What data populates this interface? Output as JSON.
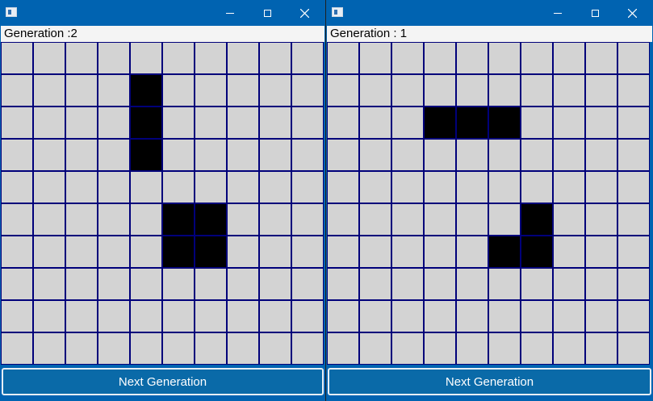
{
  "windows": [
    {
      "generation_label": "Generation :2",
      "button_label": "Next Generation",
      "controls": [
        "minimize-icon",
        "maximize-icon",
        "close-icon"
      ],
      "grid": {
        "rows": 10,
        "cols": 10,
        "alive": [
          [
            1,
            4
          ],
          [
            2,
            4
          ],
          [
            3,
            4
          ],
          [
            5,
            5
          ],
          [
            5,
            6
          ],
          [
            6,
            5
          ],
          [
            6,
            6
          ]
        ]
      }
    },
    {
      "generation_label": "Generation : 1",
      "button_label": "Next Generation",
      "controls": [
        "minimize-icon",
        "maximize-icon",
        "close-icon"
      ],
      "grid": {
        "rows": 10,
        "cols": 10,
        "alive": [
          [
            2,
            3
          ],
          [
            2,
            4
          ],
          [
            2,
            5
          ],
          [
            5,
            6
          ],
          [
            6,
            5
          ],
          [
            6,
            6
          ]
        ]
      }
    }
  ],
  "colors": {
    "titlebar": "#0063b1",
    "cell_dead": "#d3d3d3",
    "cell_alive": "#000000",
    "grid_line": "#00007a",
    "button": "#0a6aa8"
  }
}
